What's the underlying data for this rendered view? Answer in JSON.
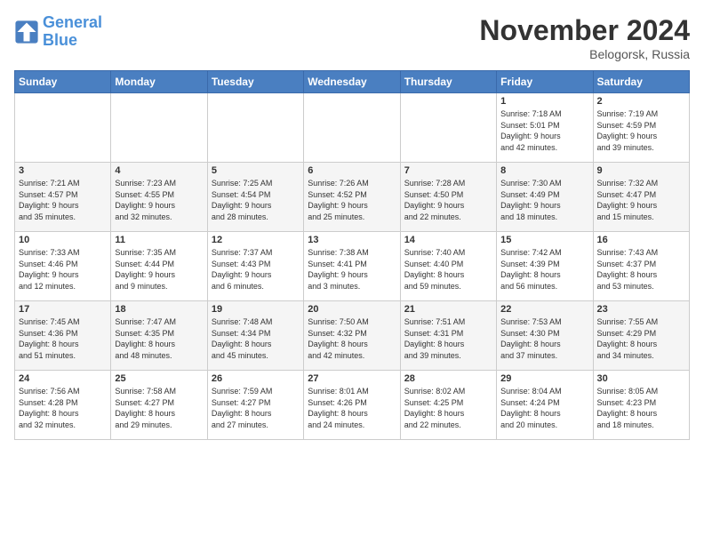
{
  "header": {
    "logo_general": "General",
    "logo_blue": "Blue",
    "month_title": "November 2024",
    "location": "Belogorsk, Russia"
  },
  "weekdays": [
    "Sunday",
    "Monday",
    "Tuesday",
    "Wednesday",
    "Thursday",
    "Friday",
    "Saturday"
  ],
  "weeks": [
    [
      {
        "day": "",
        "info": ""
      },
      {
        "day": "",
        "info": ""
      },
      {
        "day": "",
        "info": ""
      },
      {
        "day": "",
        "info": ""
      },
      {
        "day": "",
        "info": ""
      },
      {
        "day": "1",
        "info": "Sunrise: 7:18 AM\nSunset: 5:01 PM\nDaylight: 9 hours\nand 42 minutes."
      },
      {
        "day": "2",
        "info": "Sunrise: 7:19 AM\nSunset: 4:59 PM\nDaylight: 9 hours\nand 39 minutes."
      }
    ],
    [
      {
        "day": "3",
        "info": "Sunrise: 7:21 AM\nSunset: 4:57 PM\nDaylight: 9 hours\nand 35 minutes."
      },
      {
        "day": "4",
        "info": "Sunrise: 7:23 AM\nSunset: 4:55 PM\nDaylight: 9 hours\nand 32 minutes."
      },
      {
        "day": "5",
        "info": "Sunrise: 7:25 AM\nSunset: 4:54 PM\nDaylight: 9 hours\nand 28 minutes."
      },
      {
        "day": "6",
        "info": "Sunrise: 7:26 AM\nSunset: 4:52 PM\nDaylight: 9 hours\nand 25 minutes."
      },
      {
        "day": "7",
        "info": "Sunrise: 7:28 AM\nSunset: 4:50 PM\nDaylight: 9 hours\nand 22 minutes."
      },
      {
        "day": "8",
        "info": "Sunrise: 7:30 AM\nSunset: 4:49 PM\nDaylight: 9 hours\nand 18 minutes."
      },
      {
        "day": "9",
        "info": "Sunrise: 7:32 AM\nSunset: 4:47 PM\nDaylight: 9 hours\nand 15 minutes."
      }
    ],
    [
      {
        "day": "10",
        "info": "Sunrise: 7:33 AM\nSunset: 4:46 PM\nDaylight: 9 hours\nand 12 minutes."
      },
      {
        "day": "11",
        "info": "Sunrise: 7:35 AM\nSunset: 4:44 PM\nDaylight: 9 hours\nand 9 minutes."
      },
      {
        "day": "12",
        "info": "Sunrise: 7:37 AM\nSunset: 4:43 PM\nDaylight: 9 hours\nand 6 minutes."
      },
      {
        "day": "13",
        "info": "Sunrise: 7:38 AM\nSunset: 4:41 PM\nDaylight: 9 hours\nand 3 minutes."
      },
      {
        "day": "14",
        "info": "Sunrise: 7:40 AM\nSunset: 4:40 PM\nDaylight: 8 hours\nand 59 minutes."
      },
      {
        "day": "15",
        "info": "Sunrise: 7:42 AM\nSunset: 4:39 PM\nDaylight: 8 hours\nand 56 minutes."
      },
      {
        "day": "16",
        "info": "Sunrise: 7:43 AM\nSunset: 4:37 PM\nDaylight: 8 hours\nand 53 minutes."
      }
    ],
    [
      {
        "day": "17",
        "info": "Sunrise: 7:45 AM\nSunset: 4:36 PM\nDaylight: 8 hours\nand 51 minutes."
      },
      {
        "day": "18",
        "info": "Sunrise: 7:47 AM\nSunset: 4:35 PM\nDaylight: 8 hours\nand 48 minutes."
      },
      {
        "day": "19",
        "info": "Sunrise: 7:48 AM\nSunset: 4:34 PM\nDaylight: 8 hours\nand 45 minutes."
      },
      {
        "day": "20",
        "info": "Sunrise: 7:50 AM\nSunset: 4:32 PM\nDaylight: 8 hours\nand 42 minutes."
      },
      {
        "day": "21",
        "info": "Sunrise: 7:51 AM\nSunset: 4:31 PM\nDaylight: 8 hours\nand 39 minutes."
      },
      {
        "day": "22",
        "info": "Sunrise: 7:53 AM\nSunset: 4:30 PM\nDaylight: 8 hours\nand 37 minutes."
      },
      {
        "day": "23",
        "info": "Sunrise: 7:55 AM\nSunset: 4:29 PM\nDaylight: 8 hours\nand 34 minutes."
      }
    ],
    [
      {
        "day": "24",
        "info": "Sunrise: 7:56 AM\nSunset: 4:28 PM\nDaylight: 8 hours\nand 32 minutes."
      },
      {
        "day": "25",
        "info": "Sunrise: 7:58 AM\nSunset: 4:27 PM\nDaylight: 8 hours\nand 29 minutes."
      },
      {
        "day": "26",
        "info": "Sunrise: 7:59 AM\nSunset: 4:27 PM\nDaylight: 8 hours\nand 27 minutes."
      },
      {
        "day": "27",
        "info": "Sunrise: 8:01 AM\nSunset: 4:26 PM\nDaylight: 8 hours\nand 24 minutes."
      },
      {
        "day": "28",
        "info": "Sunrise: 8:02 AM\nSunset: 4:25 PM\nDaylight: 8 hours\nand 22 minutes."
      },
      {
        "day": "29",
        "info": "Sunrise: 8:04 AM\nSunset: 4:24 PM\nDaylight: 8 hours\nand 20 minutes."
      },
      {
        "day": "30",
        "info": "Sunrise: 8:05 AM\nSunset: 4:23 PM\nDaylight: 8 hours\nand 18 minutes."
      }
    ]
  ]
}
